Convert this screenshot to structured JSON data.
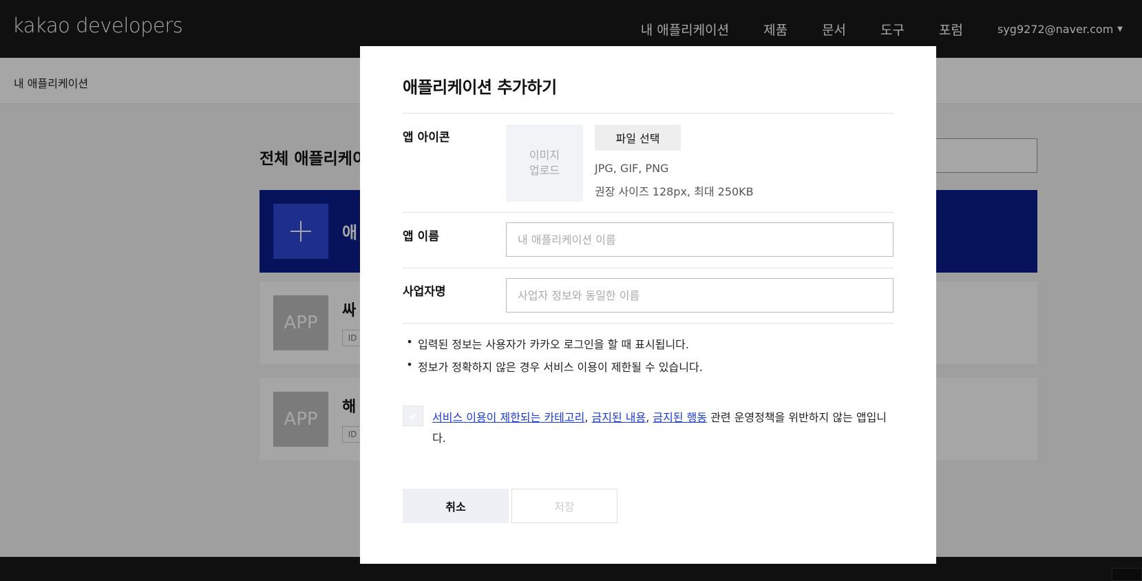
{
  "header": {
    "logo_brand": "kakao",
    "logo_product": "developers",
    "nav": [
      "내 애플리케이션",
      "제품",
      "문서",
      "도구",
      "포럼"
    ],
    "user_email": "syg9272@naver.com"
  },
  "subnav": {
    "label": "내 애플리케이션"
  },
  "background": {
    "heading": "전체 애플리케이",
    "add_card_label": "애",
    "apps": [
      {
        "thumb": "APP",
        "name": "싸",
        "id_label": "ID"
      },
      {
        "thumb": "APP",
        "name": "해",
        "id_label": "ID"
      }
    ]
  },
  "modal": {
    "title": "애플리케이션 추가하기",
    "icon_label": "앱 아이콘",
    "upload_line1": "이미지",
    "upload_line2": "업로드",
    "file_button": "파일 선택",
    "format_hint": "JPG, GIF, PNG",
    "size_hint": "권장 사이즈 128px, 최대 250KB",
    "app_name_label": "앱 이름",
    "app_name_placeholder": "내 애플리케이션 이름",
    "app_name_value": "",
    "company_label": "사업자명",
    "company_placeholder": "사업자 정보와 동일한 이름",
    "company_value": "",
    "notes": [
      "입력된 정보는 사용자가 카카오 로그인을 할 때 표시됩니다.",
      "정보가 정확하지 않은 경우 서비스 이용이 제한될 수 있습니다."
    ],
    "agree": {
      "link1": "서비스 이용이 제한되는 카테고리",
      "sep1": ", ",
      "link2": "금지된 내용",
      "sep2": ", ",
      "link3": "금지된 행동",
      "rest": " 관련 운영정책을 위반하지 않는 앱입니다."
    },
    "cancel_button": "취소",
    "save_button": "저장"
  },
  "colors": {
    "topbar": "#191919",
    "add_card": "#0a1c8a",
    "add_plus": "#2f47d8",
    "link": "#1a3ad8"
  }
}
